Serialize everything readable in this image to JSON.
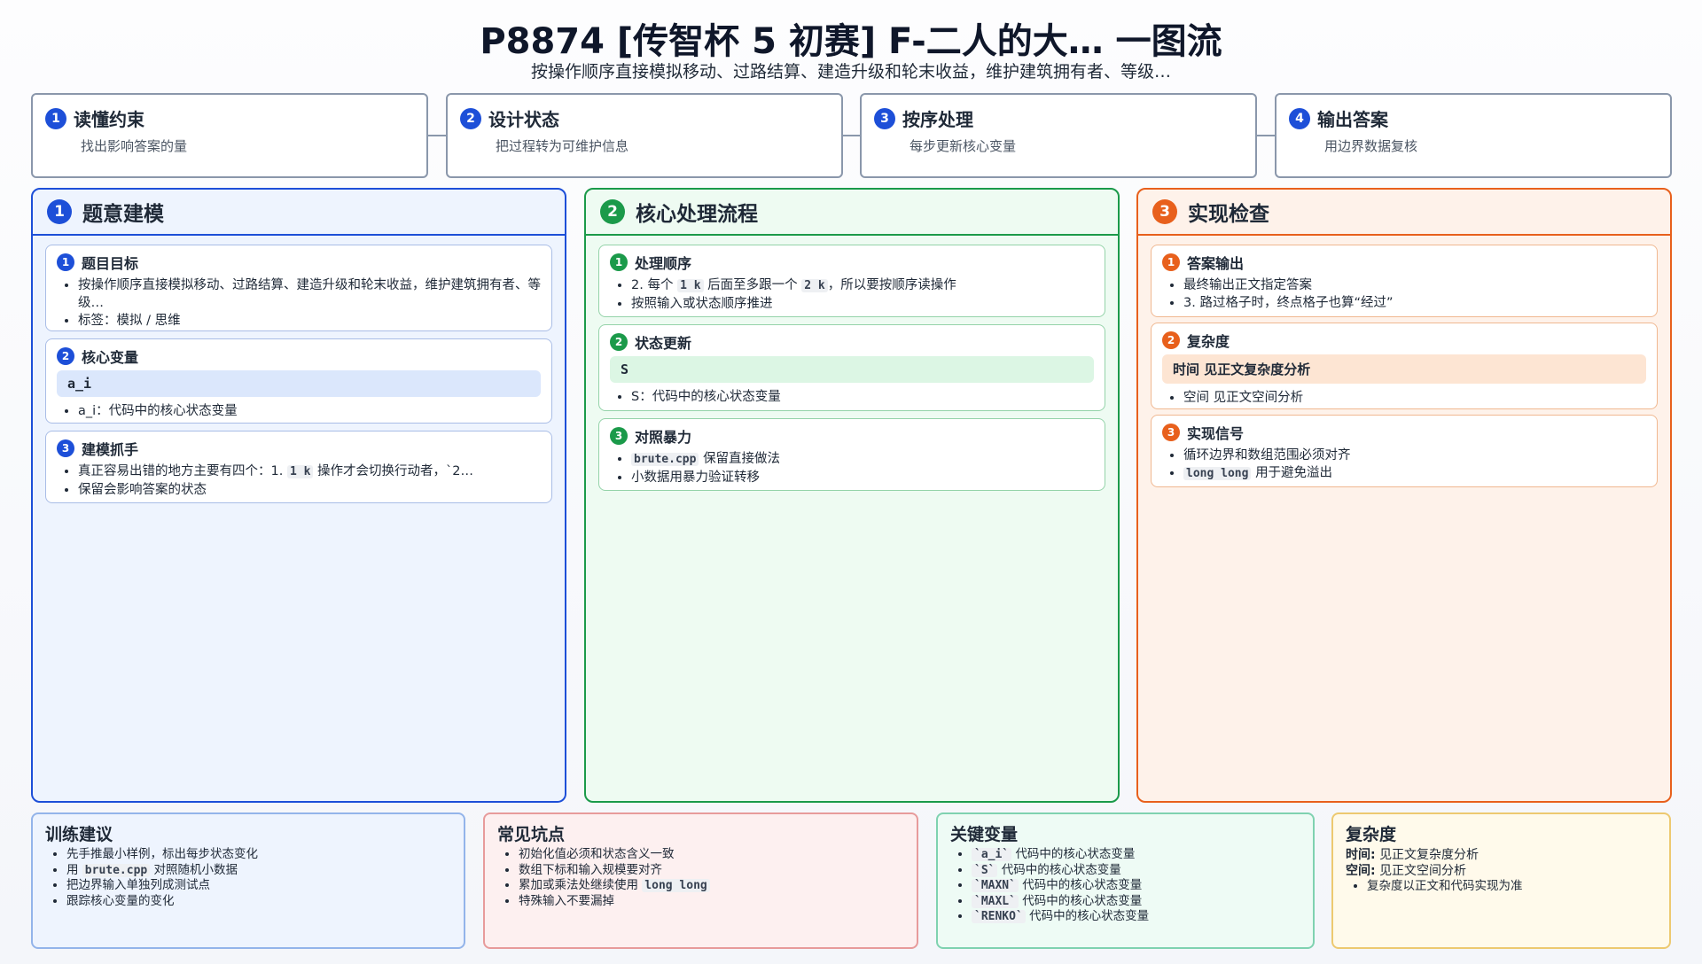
{
  "header": {
    "title": "P8874 [传智杯 5 初赛] F-二人的大… 一图流",
    "subtitle": "按操作顺序直接模拟移动、过路结算、建造升级和轮末收益，维护建筑拥有者、等级…"
  },
  "steps": [
    {
      "num": "1",
      "title": "读懂约束",
      "desc": "找出影响答案的量"
    },
    {
      "num": "2",
      "title": "设计状态",
      "desc": "把过程转为可维护信息"
    },
    {
      "num": "3",
      "title": "按序处理",
      "desc": "每步更新核心变量"
    },
    {
      "num": "4",
      "title": "输出答案",
      "desc": "用边界数据复核"
    }
  ],
  "panels": {
    "modeling": {
      "num": "1",
      "title": "题意建模",
      "goal": {
        "num": "1",
        "title": "题目目标",
        "b1": "按操作顺序直接模拟移动、过路结算、建造升级和轮末收益，维护建筑拥有者、等级…",
        "b2": "标签：模拟 / 思维"
      },
      "vars": {
        "num": "2",
        "title": "核心变量",
        "code": "a_i",
        "b1": "a_i：代码中的核心状态变量"
      },
      "grip": {
        "num": "3",
        "title": "建模抓手",
        "b1_pre": "真正容易出错的地方主要有四个：1.",
        "b1_code": "1 k",
        "b1_post": "操作才会切换行动者，`2…",
        "b2": "保留会影响答案的状态"
      }
    },
    "flow": {
      "num": "2",
      "title": "核心处理流程",
      "order": {
        "num": "1",
        "title": "处理顺序",
        "b1_pre": "2. 每个",
        "b1_code1": "1 k",
        "b1_mid": "后面至多跟一个",
        "b1_code2": "2 k",
        "b1_post": "，所以要按顺序读操作",
        "b2": "按照输入或状态顺序推进"
      },
      "update": {
        "num": "2",
        "title": "状态更新",
        "code": "S",
        "b1": "S：代码中的核心状态变量"
      },
      "brute": {
        "num": "3",
        "title": "对照暴力",
        "b1_code": "brute.cpp",
        "b1_post": "保留直接做法",
        "b2": "小数据用暴力验证转移"
      }
    },
    "check": {
      "num": "3",
      "title": "实现检查",
      "output": {
        "num": "1",
        "title": "答案输出",
        "b1": "最终输出正文指定答案",
        "b2": "3. 路过格子时，终点格子也算“经过”"
      },
      "complexity": {
        "num": "2",
        "title": "复杂度",
        "hl": "时间 见正文复杂度分析",
        "b1": "空间 见正文空间分析"
      },
      "signal": {
        "num": "3",
        "title": "实现信号",
        "b1": "循环边界和数组范围必须对齐",
        "b2_code": "long long",
        "b2_post": "用于避免溢出"
      }
    }
  },
  "bottom": {
    "training": {
      "title": "训练建议",
      "b1": "先手推最小样例，标出每步状态变化",
      "b2_pre": "用",
      "b2_code": "brute.cpp",
      "b2_post": "对照随机小数据",
      "b3": "把边界输入单独列成测试点",
      "b4": "跟踪核心变量的变化"
    },
    "pitfalls": {
      "title": "常见坑点",
      "b1": "初始化值必须和状态含义一致",
      "b2": "数组下标和输入规模要对齐",
      "b3_pre": "累加或乘法处继续使用",
      "b3_code": "long long",
      "b4": "特殊输入不要漏掉"
    },
    "keyvars": {
      "title": "关键变量",
      "items": [
        {
          "code": "`a_i`",
          "desc": "代码中的核心状态变量"
        },
        {
          "code": "`S`",
          "desc": "代码中的核心状态变量"
        },
        {
          "code": "`MAXN`",
          "desc": "代码中的核心状态变量"
        },
        {
          "code": "`MAXL`",
          "desc": "代码中的核心状态变量"
        },
        {
          "code": "`RENKO`",
          "desc": "代码中的核心状态变量"
        }
      ]
    },
    "complexity": {
      "title": "复杂度",
      "time_label": "时间:",
      "time": "见正文复杂度分析",
      "space_label": "空间:",
      "space": "见正文空间分析",
      "b1": "复杂度以正文和代码实现为准"
    }
  }
}
